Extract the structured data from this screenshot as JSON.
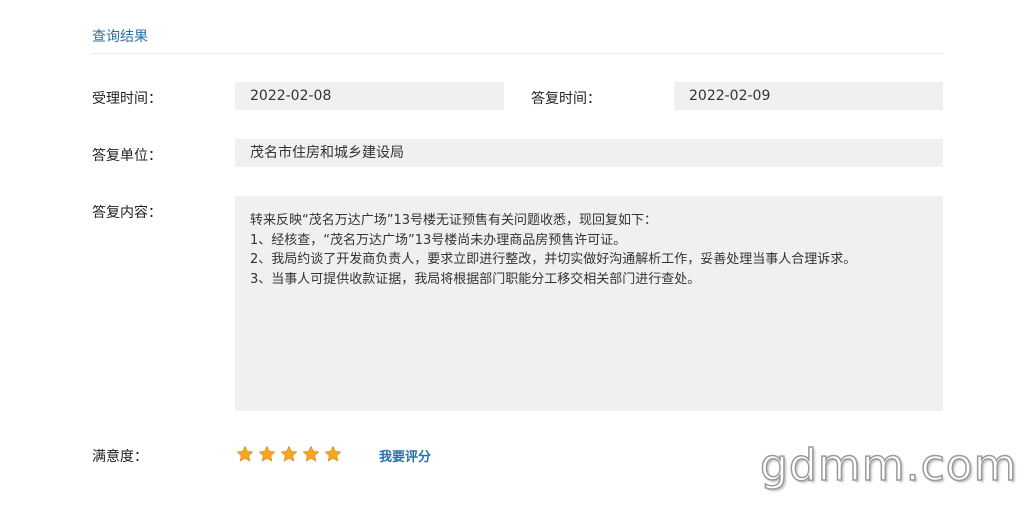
{
  "section": {
    "title": "查询结果"
  },
  "fields": {
    "accept_time_label": "受理时间：",
    "accept_time_value": "2022-02-08",
    "reply_time_label": "答复时间：",
    "reply_time_value": "2022-02-09",
    "reply_unit_label": "答复单位：",
    "reply_unit_value": "茂名市住房和城乡建设局",
    "reply_content_label": "答复内容："
  },
  "reply_content": {
    "lines": [
      "转来反映“茂名万达广场”13号楼无证预售有关问题收悉，现回复如下：",
      "1、经核查，“茂名万达广场”13号楼尚未办理商品房预售许可证。",
      "2、我局约谈了开发商负责人，要求立即进行整改，并切实做好沟通解析工作，妥善处理当事人合理诉求。",
      "3、当事人可提供收款证据，我局将根据部门职能分工移交相关部门进行查处。"
    ]
  },
  "satisfaction": {
    "label": "满意度：",
    "rating": 5,
    "max_rating": 5,
    "star_color": "#f5a623",
    "rate_link": "我要评分"
  },
  "watermark": {
    "text": "gdmm.com"
  }
}
